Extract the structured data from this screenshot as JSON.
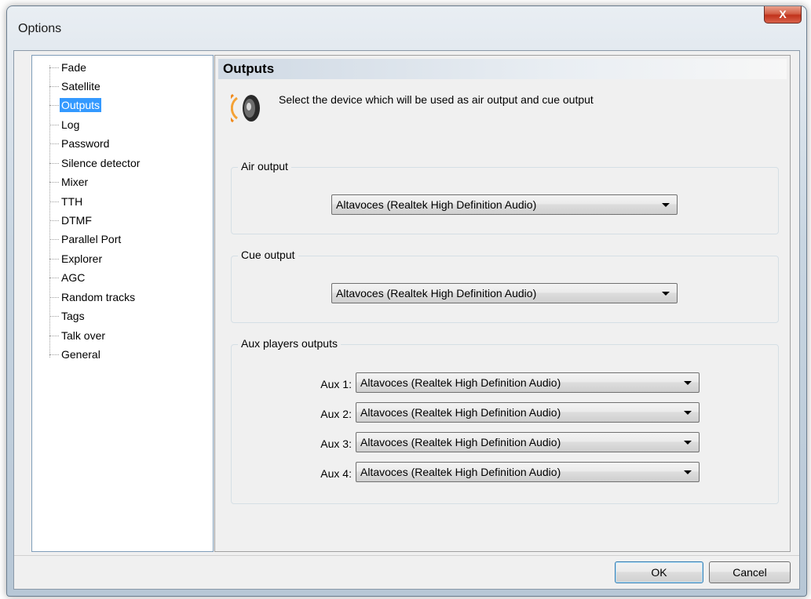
{
  "window": {
    "title": "Options",
    "close_glyph": "X"
  },
  "tree": {
    "items": [
      {
        "label": "Fade"
      },
      {
        "label": "Satellite"
      },
      {
        "label": "Outputs",
        "selected": true
      },
      {
        "label": "Log"
      },
      {
        "label": "Password"
      },
      {
        "label": "Silence detector"
      },
      {
        "label": "Mixer"
      },
      {
        "label": "TTH"
      },
      {
        "label": "DTMF"
      },
      {
        "label": "Parallel Port"
      },
      {
        "label": "Explorer"
      },
      {
        "label": "AGC"
      },
      {
        "label": "Random tracks"
      },
      {
        "label": "Tags"
      },
      {
        "label": "Talk over"
      },
      {
        "label": "General"
      }
    ]
  },
  "page": {
    "header": "Outputs",
    "icon": "speaker-icon",
    "description": "Select the device which will be used as air output and cue output",
    "air_output": {
      "label": "Air output",
      "value": "Altavoces (Realtek High Definition Audio)"
    },
    "cue_output": {
      "label": "Cue output",
      "value": "Altavoces (Realtek High Definition Audio)"
    },
    "aux_outputs": {
      "label": "Aux players outputs",
      "items": [
        {
          "label": "Aux 1:",
          "value": "Altavoces (Realtek High Definition Audio)"
        },
        {
          "label": "Aux 2:",
          "value": "Altavoces (Realtek High Definition Audio)"
        },
        {
          "label": "Aux 3:",
          "value": "Altavoces (Realtek High Definition Audio)"
        },
        {
          "label": "Aux 4:",
          "value": "Altavoces (Realtek High Definition Audio)"
        }
      ]
    }
  },
  "buttons": {
    "ok": "OK",
    "cancel": "Cancel"
  },
  "colors": {
    "selection": "#3399ff",
    "speaker_orange": "#f08a1c"
  }
}
